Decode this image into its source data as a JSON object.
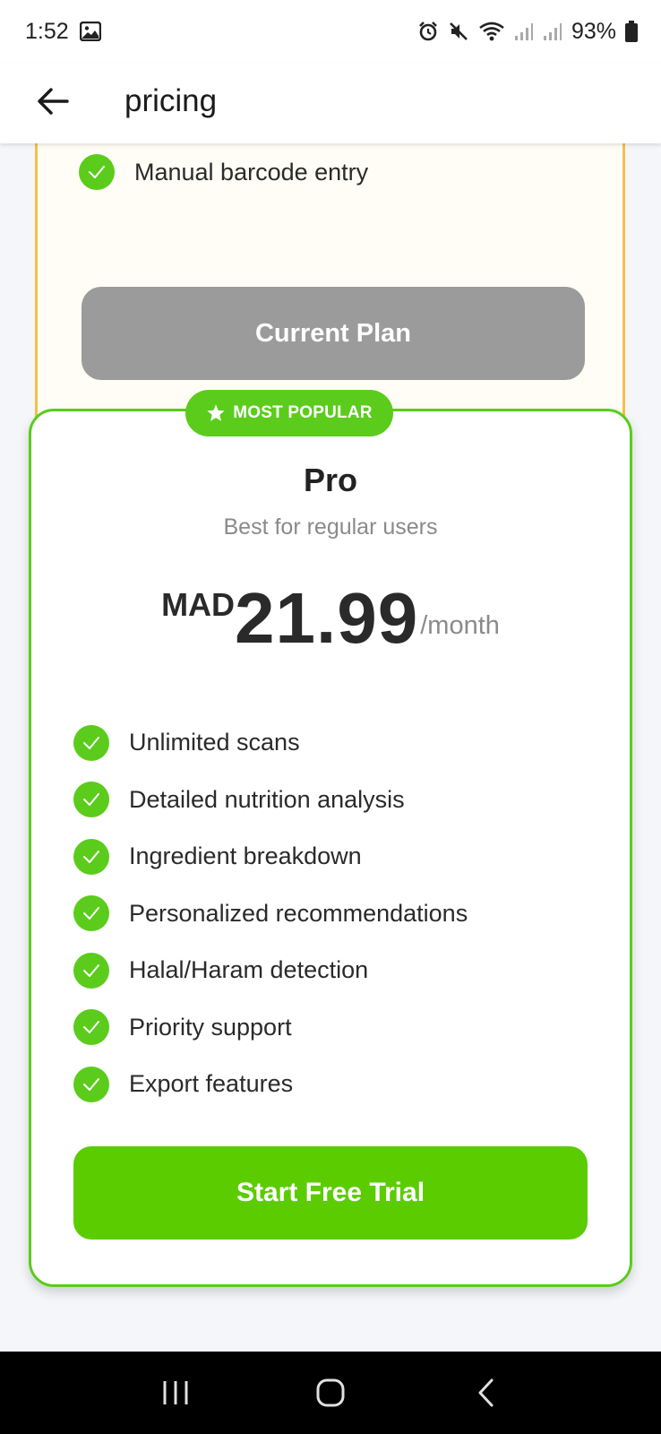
{
  "status_bar": {
    "time": "1:52",
    "battery": "93%"
  },
  "app_bar": {
    "title": "pricing"
  },
  "basic_plan": {
    "visible_feature": "Manual barcode entry",
    "button_label": "Current Plan"
  },
  "pro_plan": {
    "badge": "MOST POPULAR",
    "name": "Pro",
    "subtitle": "Best for regular users",
    "currency": "MAD",
    "price": "21.99",
    "period": "/month",
    "features": [
      "Unlimited scans",
      "Detailed nutrition analysis",
      "Ingredient breakdown",
      "Personalized recommendations",
      "Halal/Haram detection",
      "Priority support",
      "Export features"
    ],
    "button_label": "Start Free Trial"
  },
  "colors": {
    "accent_green": "#5bcc1b",
    "basic_border": "#f5c04a",
    "current_plan_gray": "#9b9b9b"
  },
  "icons": {
    "back": "arrow-left-icon",
    "check": "check-circle-icon",
    "star": "star-icon",
    "nav_recents": "recents-icon",
    "nav_home": "home-icon",
    "nav_back": "chevron-left-icon"
  }
}
